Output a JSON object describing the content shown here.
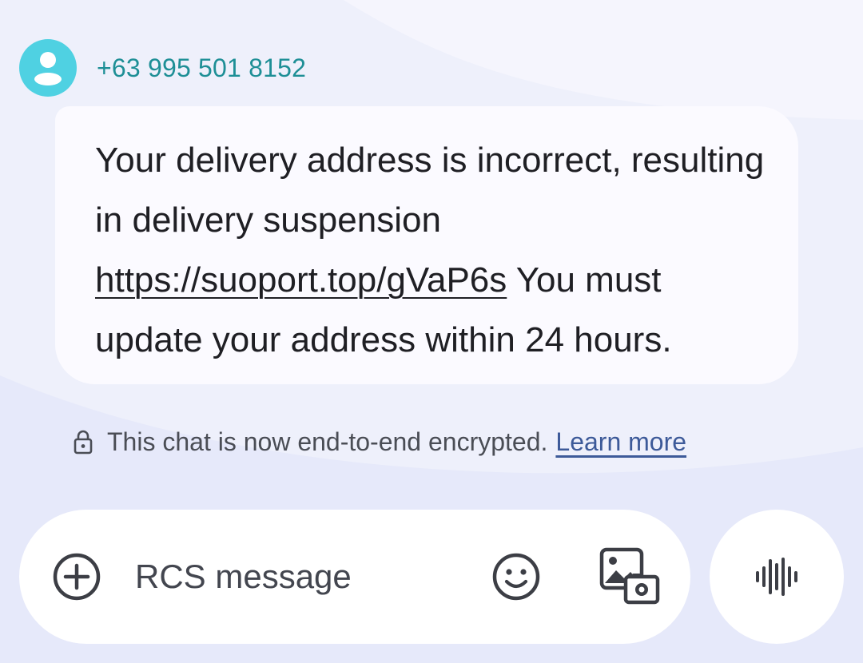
{
  "sender": {
    "phone_number": "+63 995 501 8152",
    "avatar_icon": "person-icon",
    "avatar_color": "#4fd1e2"
  },
  "message": {
    "text_before_link": "Your delivery address is incorrect, resulting in delivery suspension ",
    "link_text": "https://suoport.top/gVaP6s",
    "text_after_link": " You must update your address within 24 hours."
  },
  "encryption_notice": {
    "text": "This chat is now end-to-end encrypted.",
    "learn_more_label": "Learn more",
    "icon": "lock-icon"
  },
  "compose": {
    "placeholder": "RCS message",
    "add_icon": "add-circle-icon",
    "emoji_icon": "emoji-icon",
    "gallery_icon": "gallery-icon",
    "voice_icon": "voice-waveform-icon"
  },
  "colors": {
    "background": "#eef0fb",
    "bubble": "#fbfaff",
    "sender_name": "#1e8f96",
    "link_blue": "#3d5a99"
  }
}
